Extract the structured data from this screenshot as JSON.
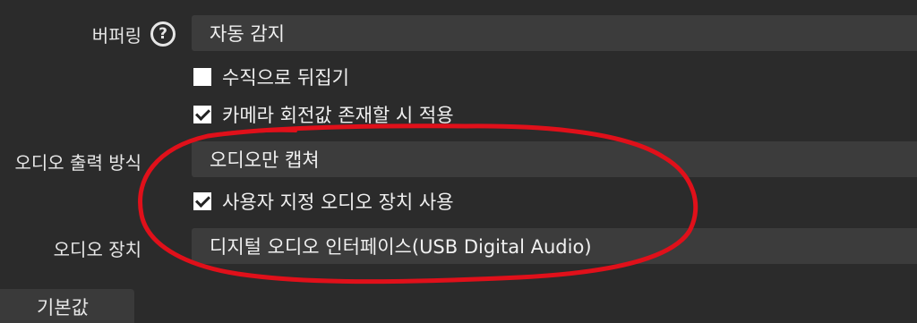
{
  "buffering": {
    "label": "버퍼링",
    "value": "자동 감지",
    "help_icon": "question-circle-icon"
  },
  "checkboxes": {
    "flip_vertical": {
      "label": "수직으로 뒤집기",
      "checked": false
    },
    "camera_rotation": {
      "label": "카메라 회전값 존재할 시 적용",
      "checked": true
    },
    "custom_audio_device": {
      "label": "사용자 지정 오디오 장치 사용",
      "checked": true
    }
  },
  "audio_output_mode": {
    "label": "오디오 출력 방식",
    "value": "오디오만 캡쳐"
  },
  "audio_device": {
    "label": "오디오 장치",
    "value": "디지털 오디오 인터페이스(USB Digital Audio)"
  },
  "footer": {
    "defaults_label": "기본값"
  },
  "colors": {
    "background": "#2b2b2b",
    "field": "#3c3c3c",
    "annotation": "#e0101a"
  }
}
